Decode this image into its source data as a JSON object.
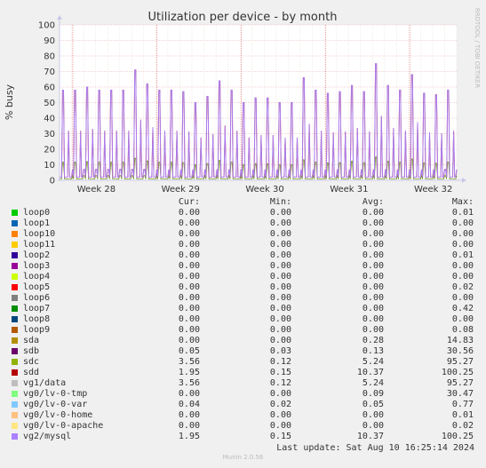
{
  "chart_data": {
    "type": "line",
    "title": "Utilization per device - by month",
    "ylabel": "% busy",
    "ylim": [
      0,
      100
    ],
    "yticks": [
      0,
      10,
      20,
      30,
      40,
      50,
      60,
      70,
      80,
      90,
      100
    ],
    "xticks": [
      "Week 28",
      "Week 29",
      "Week 30",
      "Week 31",
      "Week 32"
    ],
    "grid": true,
    "side_label": "RRDTOOL / TOBI OETIKER",
    "series": [
      {
        "name": "sdd",
        "color": "#cc3118"
      },
      {
        "name": "vg2/mysql",
        "color": "#aa7cee"
      },
      {
        "name": "sdc",
        "color": "#6f8f1f"
      }
    ],
    "peaks": [
      {
        "day": 0.3,
        "value": 58
      },
      {
        "day": 1.3,
        "value": 58
      },
      {
        "day": 2.3,
        "value": 60
      },
      {
        "day": 3.3,
        "value": 58
      },
      {
        "day": 4.3,
        "value": 58
      },
      {
        "day": 5.3,
        "value": 58
      },
      {
        "day": 6.3,
        "value": 71
      },
      {
        "day": 7.3,
        "value": 62
      },
      {
        "day": 8.3,
        "value": 58
      },
      {
        "day": 9.3,
        "value": 58
      },
      {
        "day": 10.3,
        "value": 57
      },
      {
        "day": 11.3,
        "value": 50
      },
      {
        "day": 12.3,
        "value": 54
      },
      {
        "day": 13.3,
        "value": 64
      },
      {
        "day": 14.3,
        "value": 58
      },
      {
        "day": 15.3,
        "value": 50
      },
      {
        "day": 16.3,
        "value": 53
      },
      {
        "day": 17.3,
        "value": 53
      },
      {
        "day": 18.3,
        "value": 50
      },
      {
        "day": 19.3,
        "value": 50
      },
      {
        "day": 20.3,
        "value": 66
      },
      {
        "day": 21.3,
        "value": 58
      },
      {
        "day": 22.3,
        "value": 56
      },
      {
        "day": 23.3,
        "value": 57
      },
      {
        "day": 24.3,
        "value": 61
      },
      {
        "day": 25.3,
        "value": 57
      },
      {
        "day": 26.3,
        "value": 75
      },
      {
        "day": 27.3,
        "value": 61
      },
      {
        "day": 28.3,
        "value": 58
      },
      {
        "day": 29.3,
        "value": 68
      },
      {
        "day": 30.3,
        "value": 56
      },
      {
        "day": 31.3,
        "value": 55
      },
      {
        "day": 32.3,
        "value": 58
      }
    ]
  },
  "legend": {
    "headers": {
      "cur": "Cur:",
      "min": "Min:",
      "avg": "Avg:",
      "max": "Max:"
    },
    "rows": [
      {
        "name": "loop0",
        "color": "#00cc00",
        "cur": "0.00",
        "min": "0.00",
        "avg": "0.00",
        "max": "0.01"
      },
      {
        "name": "loop1",
        "color": "#0066b3",
        "cur": "0.00",
        "min": "0.00",
        "avg": "0.00",
        "max": "0.00"
      },
      {
        "name": "loop10",
        "color": "#ff8000",
        "cur": "0.00",
        "min": "0.00",
        "avg": "0.00",
        "max": "0.00"
      },
      {
        "name": "loop11",
        "color": "#ffcc00",
        "cur": "0.00",
        "min": "0.00",
        "avg": "0.00",
        "max": "0.00"
      },
      {
        "name": "loop2",
        "color": "#330099",
        "cur": "0.00",
        "min": "0.00",
        "avg": "0.00",
        "max": "0.01"
      },
      {
        "name": "loop3",
        "color": "#990099",
        "cur": "0.00",
        "min": "0.00",
        "avg": "0.00",
        "max": "0.00"
      },
      {
        "name": "loop4",
        "color": "#ccff00",
        "cur": "0.00",
        "min": "0.00",
        "avg": "0.00",
        "max": "0.00"
      },
      {
        "name": "loop5",
        "color": "#ff0000",
        "cur": "0.00",
        "min": "0.00",
        "avg": "0.00",
        "max": "0.02"
      },
      {
        "name": "loop6",
        "color": "#808080",
        "cur": "0.00",
        "min": "0.00",
        "avg": "0.00",
        "max": "0.00"
      },
      {
        "name": "loop7",
        "color": "#008f00",
        "cur": "0.00",
        "min": "0.00",
        "avg": "0.00",
        "max": "0.42"
      },
      {
        "name": "loop8",
        "color": "#00487d",
        "cur": "0.00",
        "min": "0.00",
        "avg": "0.00",
        "max": "0.00"
      },
      {
        "name": "loop9",
        "color": "#b35a00",
        "cur": "0.00",
        "min": "0.00",
        "avg": "0.00",
        "max": "0.08"
      },
      {
        "name": "sda",
        "color": "#b38f00",
        "cur": "0.00",
        "min": "0.00",
        "avg": "0.28",
        "max": "14.83"
      },
      {
        "name": "sdb",
        "color": "#6b006b",
        "cur": "0.05",
        "min": "0.03",
        "avg": "0.13",
        "max": "30.56"
      },
      {
        "name": "sdc",
        "color": "#8fb300",
        "cur": "3.56",
        "min": "0.12",
        "avg": "5.24",
        "max": "95.27"
      },
      {
        "name": "sdd",
        "color": "#b30000",
        "cur": "1.95",
        "min": "0.15",
        "avg": "10.37",
        "max": "100.25"
      },
      {
        "name": "vg1/data",
        "color": "#bebebe",
        "cur": "3.56",
        "min": "0.12",
        "avg": "5.24",
        "max": "95.27"
      },
      {
        "name": "vg0/lv-0-tmp",
        "color": "#80ff80",
        "cur": "0.00",
        "min": "0.00",
        "avg": "0.09",
        "max": "30.47"
      },
      {
        "name": "vg0/lv-0-var",
        "color": "#80c9ff",
        "cur": "0.04",
        "min": "0.02",
        "avg": "0.05",
        "max": "0.77"
      },
      {
        "name": "vg0/lv-0-home",
        "color": "#ffc080",
        "cur": "0.00",
        "min": "0.00",
        "avg": "0.00",
        "max": "0.01"
      },
      {
        "name": "vg0/lv-0-apache",
        "color": "#ffe680",
        "cur": "0.00",
        "min": "0.00",
        "avg": "0.00",
        "max": "0.02"
      },
      {
        "name": "vg2/mysql",
        "color": "#aa80ff",
        "cur": "1.95",
        "min": "0.15",
        "avg": "10.37",
        "max": "100.25"
      }
    ]
  },
  "footer": {
    "last_update": "Last update: Sat Aug 10 16:25:14 2024",
    "munin": "Munin 2.0.56"
  }
}
